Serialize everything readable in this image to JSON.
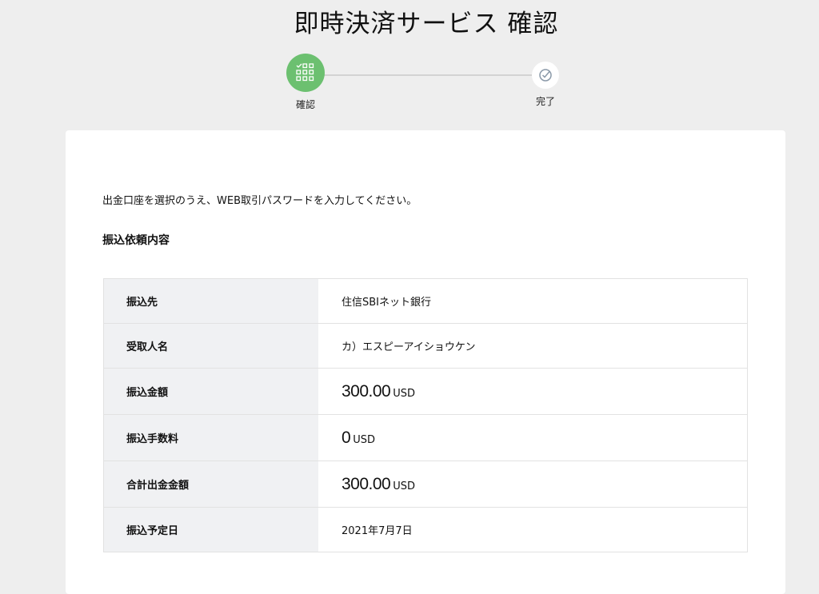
{
  "page": {
    "title": "即時決済サービス 確認"
  },
  "stepper": {
    "steps": [
      {
        "label": "確認",
        "state": "active",
        "icon": "grid-check-icon"
      },
      {
        "label": "完了",
        "state": "pending",
        "icon": "check-circle-icon"
      }
    ],
    "colors": {
      "active": "#6cc070",
      "line": "#d3d3d3"
    }
  },
  "main": {
    "instruction": "出金口座を選択のうえ、WEB取引パスワードを入力してください。",
    "section_title": "振込依頼内容",
    "rows": [
      {
        "label": "振込先",
        "value": "住信SBIネット銀行"
      },
      {
        "label": "受取人名",
        "value": "カ）エスピーアイショウケン"
      },
      {
        "label": "振込金額",
        "amount": "300.00",
        "unit": "USD"
      },
      {
        "label": "振込手数料",
        "amount": "0",
        "unit": "USD"
      },
      {
        "label": "合計出金金額",
        "amount": "300.00",
        "unit": "USD"
      },
      {
        "label": "振込予定日",
        "value": "2021年7月7日"
      }
    ]
  }
}
